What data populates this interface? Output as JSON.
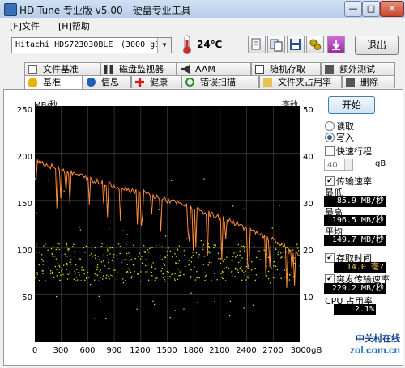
{
  "window": {
    "title": "HD Tune 专业版 v5.00 - 硬盘专业工具",
    "buttons": [
      "—",
      "□",
      "✕"
    ]
  },
  "menu": [
    "[F]文件",
    "[H]帮助"
  ],
  "toolbar": {
    "drive_name": "Hitachi HDS723030BLE",
    "drive_capacity": "(3000 gB)",
    "temperature": "24℃",
    "exit_label": "退出",
    "icons": [
      "copy-text-icon",
      "copy-screen-icon",
      "save-icon",
      "options-icon",
      "download-icon"
    ]
  },
  "tabs_top": [
    "文件基准",
    "磁盘监视器",
    "AAM",
    "随机存取",
    "额外测试"
  ],
  "tabs_bottom": [
    "基准",
    "信息",
    "健康",
    "错误扫描",
    "文件夹占用率",
    "删除"
  ],
  "colors": {
    "transfer_line": "#ff8c3a",
    "access_dots": "#e6e600",
    "plot_bg": "#000000",
    "grid": "#4a4a4a"
  },
  "chart_data": {
    "type": "line",
    "y_left_label": "MB/秒",
    "y_right_label": "毫秒",
    "y_left_ticks": [
      "250",
      "200",
      "150",
      "100",
      "50"
    ],
    "y_right_ticks": [
      "50",
      "40",
      "30",
      "20",
      "10"
    ],
    "x_ticks": [
      "0",
      "300",
      "600",
      "900",
      "1200",
      "1500",
      "1800",
      "2100",
      "2400",
      "2700",
      "3000gB"
    ],
    "xlim": [
      0,
      3000
    ],
    "ylim_left": [
      0,
      250
    ],
    "ylim_right": [
      0,
      50
    ],
    "series": [
      {
        "values": [
          195,
          190,
          186,
          184,
          181,
          178,
          176,
          173,
          170,
          168,
          166,
          164,
          162,
          160,
          158,
          155,
          153,
          150,
          148,
          145,
          143,
          140,
          137,
          134,
          131,
          128,
          125,
          121,
          117,
          113,
          110,
          106,
          102,
          96,
          92
        ],
        "x": [
          0,
          88,
          176,
          264,
          353,
          441,
          529,
          617,
          706,
          794,
          882,
          970,
          1059,
          1147,
          1235,
          1324,
          1412,
          1500,
          1588,
          1676,
          1765,
          1853,
          1941,
          2029,
          2118,
          2206,
          2294,
          2382,
          2471,
          2559,
          2647,
          2735,
          2824,
          2912,
          3000
        ]
      }
    ],
    "access_band_ms": [
      5,
      25
    ]
  },
  "right_panel": {
    "start_label": "开始",
    "read_label": "读取",
    "write_label": "写入",
    "selected_mode": "write",
    "quick_scan_label": "快速行程",
    "quick_scan_value": "40",
    "quick_scan_unit": "gB",
    "transfer_label": "传输速率",
    "min_label": "最低",
    "min_value": "85.9 MB/秒",
    "max_label": "最高",
    "max_value": "196.5 MB/秒",
    "avg_label": "平均",
    "avg_value": "149.7 MB/秒",
    "access_label": "存取时间",
    "access_value": "14.0 毫?",
    "burst_label": "突发传输速率",
    "burst_value": "229.2 MB/秒",
    "cpu_label": "CPU 占用率",
    "cpu_value": "2.1%"
  },
  "watermark": {
    "brand": "中关村在线",
    "url": "zol.com.cn"
  }
}
